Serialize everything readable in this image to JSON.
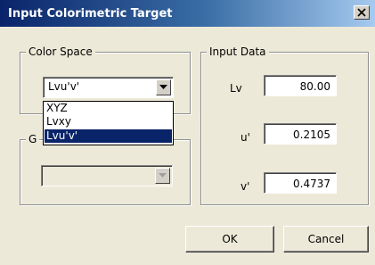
{
  "window": {
    "title": "Input Colorimetric Target",
    "close_icon": "close-icon"
  },
  "color_space": {
    "group_label": "Color Space",
    "selected_value": "Lvu'v'",
    "options": [
      "XYZ",
      "Lvxy",
      "Lvu'v'"
    ],
    "highlighted_index": 2
  },
  "second_group": {
    "label_visible_fragment": "G",
    "combo_value": ""
  },
  "input_data": {
    "group_label": "Input Data",
    "fields": [
      {
        "label": "Lv",
        "value": "80.00"
      },
      {
        "label": "u'",
        "value": "0.2105"
      },
      {
        "label": "v'",
        "value": "0.4737"
      }
    ]
  },
  "buttons": {
    "ok": "OK",
    "cancel": "Cancel"
  },
  "colors": {
    "dialog_bg": "#ECE9D8",
    "title_gradient_start": "#0A246A",
    "title_gradient_end": "#A6CAF0",
    "selection_bg": "#0A246A"
  }
}
